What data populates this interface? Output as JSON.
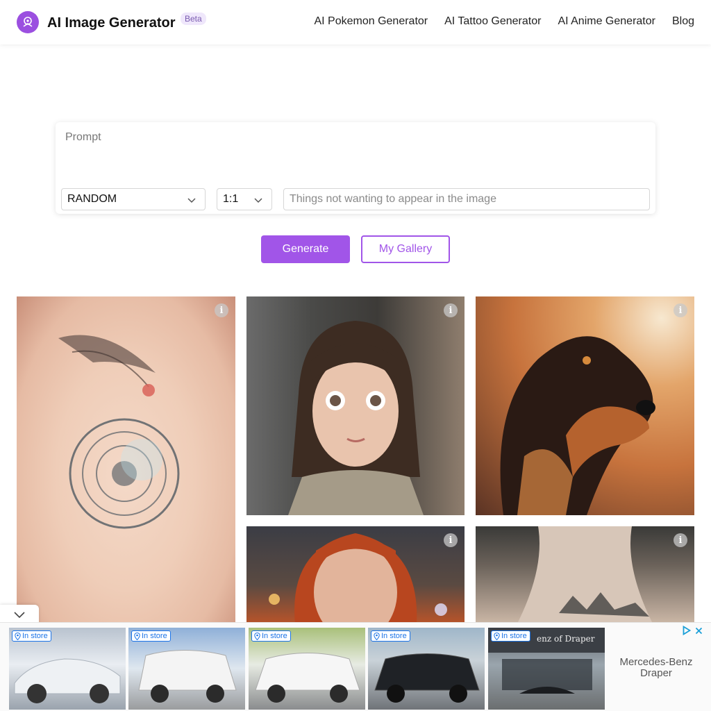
{
  "header": {
    "brand": "AI Image Generator",
    "badge": "Beta",
    "nav": [
      "AI Pokemon Generator",
      "AI Tattoo Generator",
      "AI Anime Generator",
      "Blog"
    ]
  },
  "form": {
    "prompt_placeholder": "Prompt",
    "style_value": "RANDOM",
    "ratio_value": "1:1",
    "negative_placeholder": "Things not wanting to appear in the image"
  },
  "actions": {
    "generate_label": "Generate",
    "gallery_label": "My Gallery"
  },
  "gallery": {
    "info_glyph": "i",
    "images": [
      "chest-tattoo",
      "girl-portrait",
      "dog-portrait",
      "redhead-portrait",
      "back-tattoo"
    ]
  },
  "ad": {
    "pill_label": "In store",
    "advertiser": "Mercedes-Benz Draper",
    "storefront_sign": "enz of Draper",
    "cards": 5
  },
  "colors": {
    "accent": "#a155e8",
    "ad_blue": "#1a73e8"
  }
}
